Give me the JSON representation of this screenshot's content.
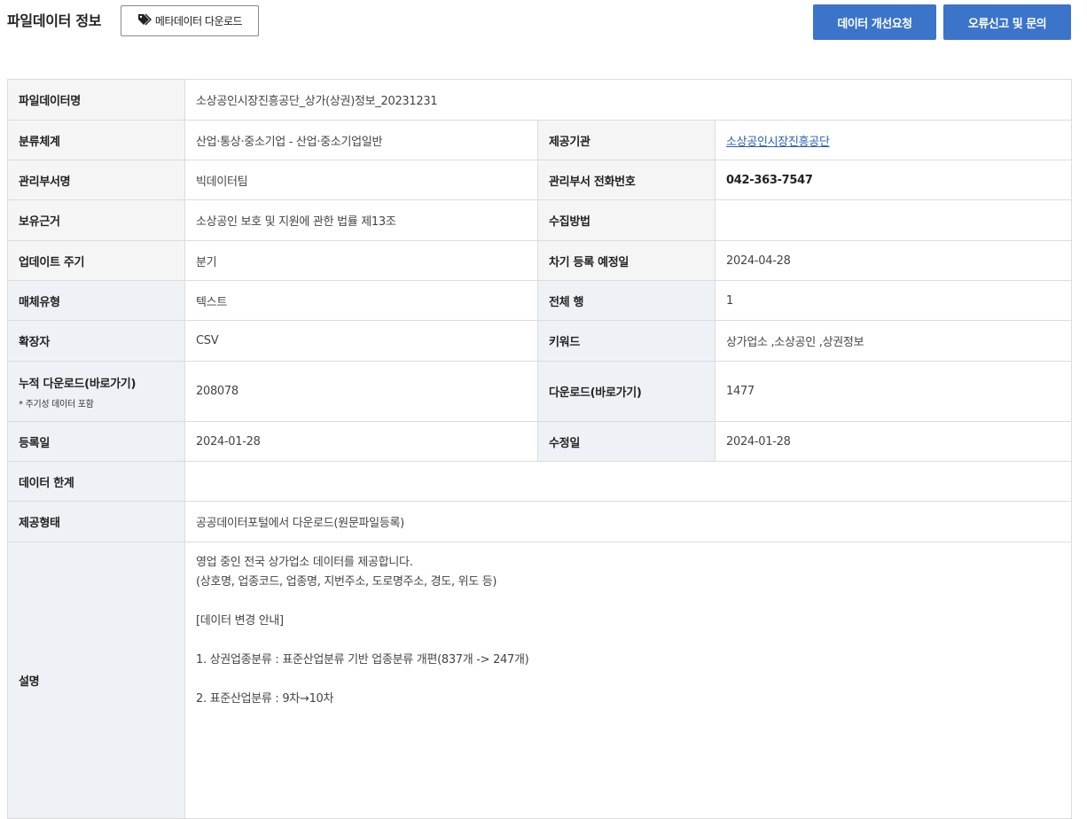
{
  "header": {
    "title": "파일데이터 정보",
    "meta_download": "메타데이터 다운로드",
    "improve_button": "데이터 개선요청",
    "report_button": "오류신고 및 문의"
  },
  "rows": {
    "file_name": {
      "label": "파일데이터명",
      "value": "소상공인시장진흥공단_상가(상권)정보_20231231"
    },
    "category": {
      "label": "분류체계",
      "value": "산업·통상·중소기업 - 산업·중소기업일반"
    },
    "provider": {
      "label": "제공기관",
      "value": "소상공인시장진흥공단"
    },
    "dept": {
      "label": "관리부서명",
      "value": "빅데이터팀"
    },
    "dept_phone": {
      "label": "관리부서 전화번호",
      "value": "042-363-7547"
    },
    "basis": {
      "label": "보유근거",
      "value": "소상공인 보호 및 지원에 관한 법률 제13조"
    },
    "collection": {
      "label": "수집방법",
      "value": ""
    },
    "update_cycle": {
      "label": "업데이트 주기",
      "value": "분기"
    },
    "next_reg": {
      "label": "차기 등록 예정일",
      "value": "2024-04-28"
    },
    "media_type": {
      "label": "매체유형",
      "value": "텍스트"
    },
    "total_rows": {
      "label": "전체 행",
      "value": "1"
    },
    "extension": {
      "label": "확장자",
      "value": "CSV"
    },
    "keywords": {
      "label": "키워드",
      "value": "상가업소 ,소상공인 ,상권정보"
    },
    "cum_download": {
      "label": "누적 다운로드(바로가기)",
      "note": "* 주기성 데이터 포함",
      "value": "208078"
    },
    "download": {
      "label": "다운로드(바로가기)",
      "value": "1477"
    },
    "reg_date": {
      "label": "등록일",
      "value": "2024-01-28"
    },
    "mod_date": {
      "label": "수정일",
      "value": "2024-01-28"
    },
    "limit": {
      "label": "데이터 한계",
      "value": ""
    },
    "provide_type": {
      "label": "제공형태",
      "value": "공공데이터포털에서 다운로드(원문파일등록)"
    },
    "description": {
      "label": "설명",
      "lines": [
        "영업 중인 전국 상가업소 데이터를 제공합니다.",
        "(상호명, 업종코드, 업종명, 지번주소, 도로명주소, 경도, 위도 등)",
        "",
        "[데이터 변경 안내]",
        "",
        "1. 상권업종분류 : 표준산업분류 기반 업종분류 개편(837개 -> 247개)",
        "",
        "2. 표준산업분류 : 9차→10차"
      ]
    }
  }
}
